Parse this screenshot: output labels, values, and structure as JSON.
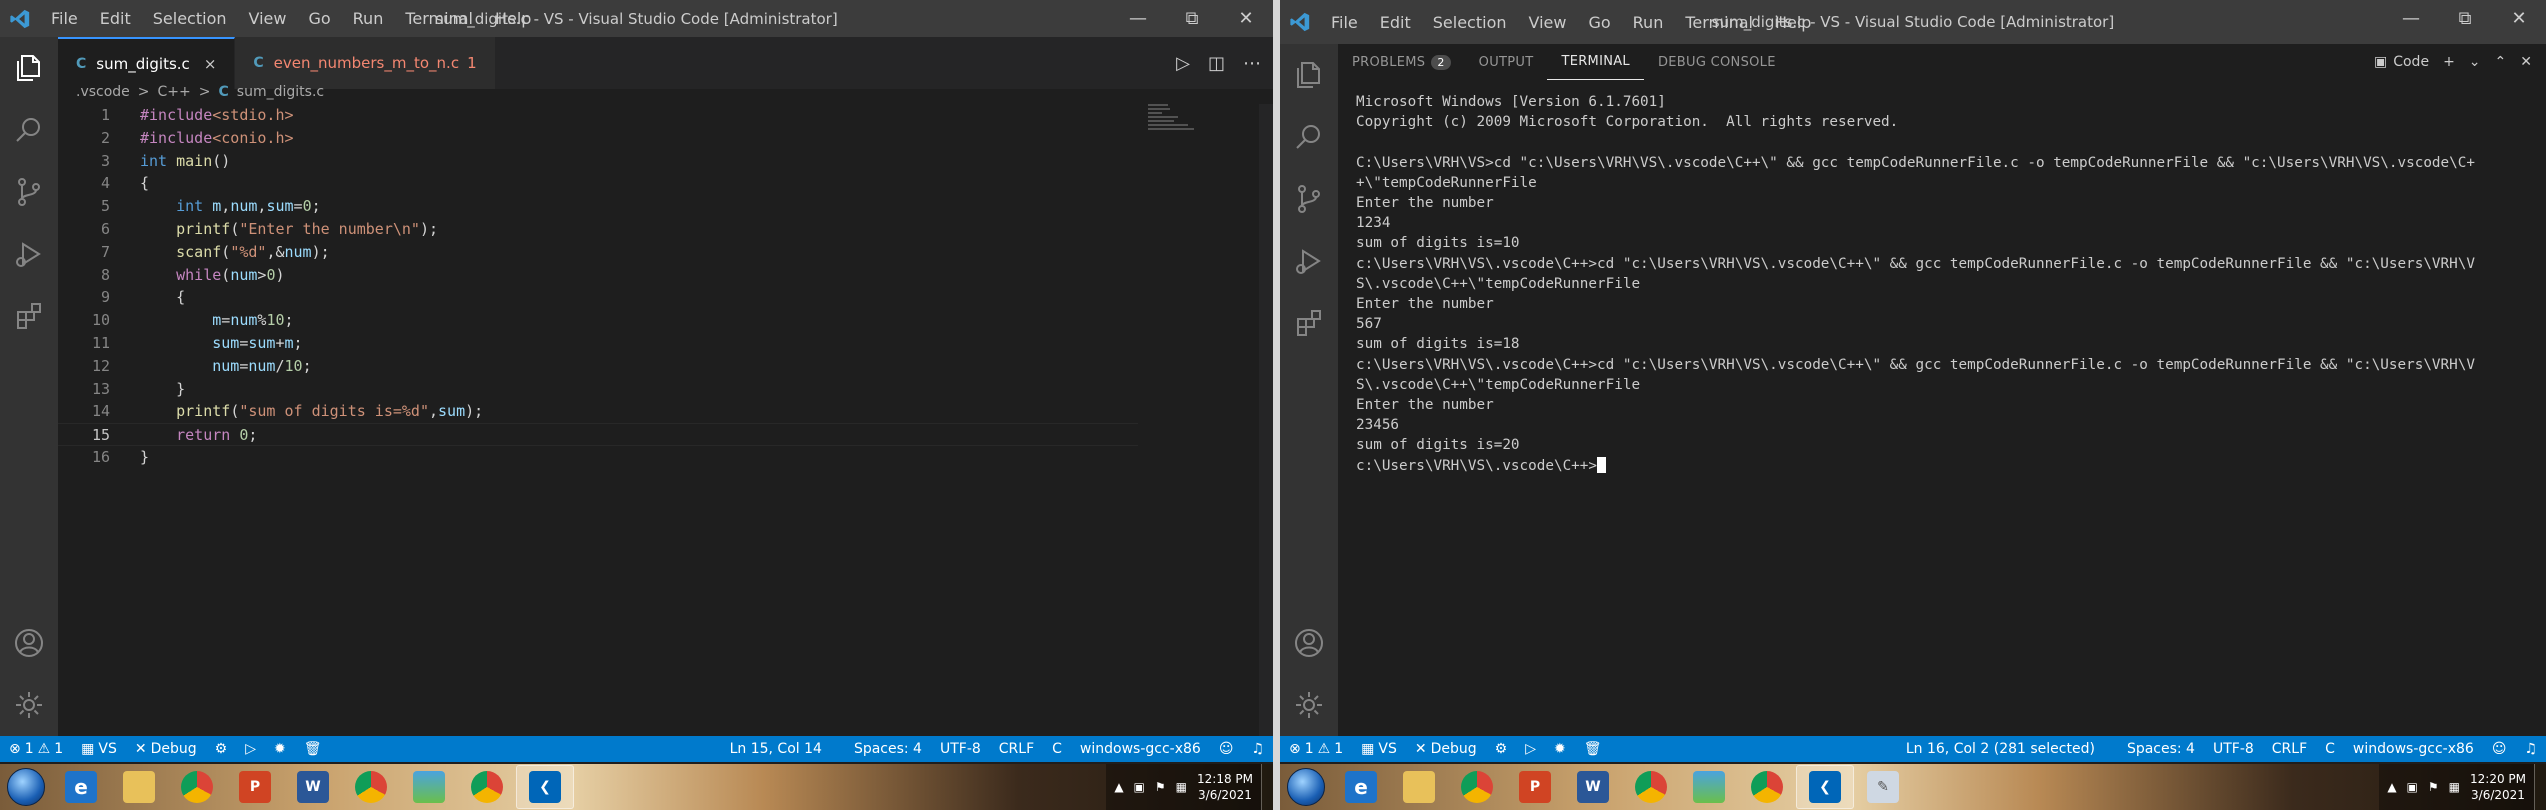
{
  "left": {
    "window_title": "sum_digits.c - VS - Visual Studio Code [Administrator]",
    "menu": [
      "File",
      "Edit",
      "Selection",
      "View",
      "Go",
      "Run",
      "Terminal",
      "Help"
    ],
    "tabs": [
      {
        "icon": "C",
        "label": "sum_digits.c",
        "close": "×"
      },
      {
        "icon": "C",
        "label": "even_numbers_m_to_n.c",
        "problems": "1"
      }
    ],
    "breadcrumb": [
      ".vscode",
      "C++",
      "sum_digits.c"
    ],
    "breadcrumb_sep": ">",
    "breadcrumb_icon": "C",
    "code": [
      {
        "n": "1",
        "text": "#include<stdio.h>"
      },
      {
        "n": "2",
        "text": "#include<conio.h>"
      },
      {
        "n": "3",
        "text": "int main()"
      },
      {
        "n": "4",
        "text": "{"
      },
      {
        "n": "5",
        "text": "    int m,num,sum=0;"
      },
      {
        "n": "6",
        "text": "    printf(\"Enter the number\\n\");"
      },
      {
        "n": "7",
        "text": "    scanf(\"%d\",&num);"
      },
      {
        "n": "8",
        "text": "    while(num>0)"
      },
      {
        "n": "9",
        "text": "    {"
      },
      {
        "n": "10",
        "text": "        m=num%10;"
      },
      {
        "n": "11",
        "text": "        sum=sum+m;"
      },
      {
        "n": "12",
        "text": "        num=num/10;"
      },
      {
        "n": "13",
        "text": "    }"
      },
      {
        "n": "14",
        "text": "    printf(\"sum of digits is=%d\",sum);"
      },
      {
        "n": "15",
        "text": "    return 0;"
      },
      {
        "n": "16",
        "text": "}"
      }
    ],
    "current_line": "15",
    "status": {
      "errors": "1",
      "warnings": "1",
      "folder": "VS",
      "debug": "Debug",
      "position": "Ln 15, Col 14",
      "spaces": "Spaces: 4",
      "encoding": "UTF-8",
      "eol": "CRLF",
      "language": "C",
      "config": "windows-gcc-x86"
    },
    "clock": {
      "time": "12:18 PM",
      "date": "3/6/2021"
    }
  },
  "right": {
    "window_title": "sum_digits.c - VS - Visual Studio Code [Administrator]",
    "menu": [
      "File",
      "Edit",
      "Selection",
      "View",
      "Go",
      "Run",
      "Terminal",
      "Help"
    ],
    "panel_tabs": [
      "PROBLEMS",
      "OUTPUT",
      "TERMINAL",
      "DEBUG CONSOLE"
    ],
    "problems_count": "2",
    "active_panel": "TERMINAL",
    "terminal_selector": "Code",
    "terminal_lines": [
      "Microsoft Windows [Version 6.1.7601]",
      "Copyright (c) 2009 Microsoft Corporation.  All rights reserved.",
      "",
      "C:\\Users\\VRH\\VS>cd \"c:\\Users\\VRH\\VS\\.vscode\\C++\\\" && gcc tempCodeRunnerFile.c -o tempCodeRunnerFile && \"c:\\Users\\VRH\\VS\\.vscode\\C+",
      "+\\\"tempCodeRunnerFile",
      "Enter the number",
      "1234",
      "sum of digits is=10",
      "c:\\Users\\VRH\\VS\\.vscode\\C++>cd \"c:\\Users\\VRH\\VS\\.vscode\\C++\\\" && gcc tempCodeRunnerFile.c -o tempCodeRunnerFile && \"c:\\Users\\VRH\\V",
      "S\\.vscode\\C++\\\"tempCodeRunnerFile",
      "Enter the number",
      "567",
      "sum of digits is=18",
      "c:\\Users\\VRH\\VS\\.vscode\\C++>cd \"c:\\Users\\VRH\\VS\\.vscode\\C++\\\" && gcc tempCodeRunnerFile.c -o tempCodeRunnerFile && \"c:\\Users\\VRH\\V",
      "S\\.vscode\\C++\\\"tempCodeRunnerFile",
      "Enter the number",
      "23456",
      "sum of digits is=20"
    ],
    "prompt": "c:\\Users\\VRH\\VS\\.vscode\\C++>",
    "status": {
      "errors": "1",
      "warnings": "1",
      "folder": "VS",
      "debug": "Debug",
      "position": "Ln 16, Col 2 (281 selected)",
      "spaces": "Spaces: 4",
      "encoding": "UTF-8",
      "eol": "CRLF",
      "language": "C",
      "config": "windows-gcc-x86"
    },
    "clock": {
      "time": "12:20 PM",
      "date": "3/6/2021"
    }
  },
  "taskbar_apps": [
    "internet-explorer-icon",
    "file-explorer-icon",
    "chrome-icon",
    "powerpoint-icon",
    "word-icon",
    "chrome-icon",
    "photos-icon",
    "chrome-icon",
    "vscode-icon"
  ],
  "colors": {
    "accent": "#007acc",
    "titlebar": "#3c3c3c",
    "editor_bg": "#1e1e1e",
    "activity_bar": "#333333",
    "keyword": "#569cd6",
    "string": "#ce9178",
    "number": "#b5cea8",
    "include": "#c586c0",
    "function": "#dcdcaa",
    "variable": "#9cdcfe"
  }
}
